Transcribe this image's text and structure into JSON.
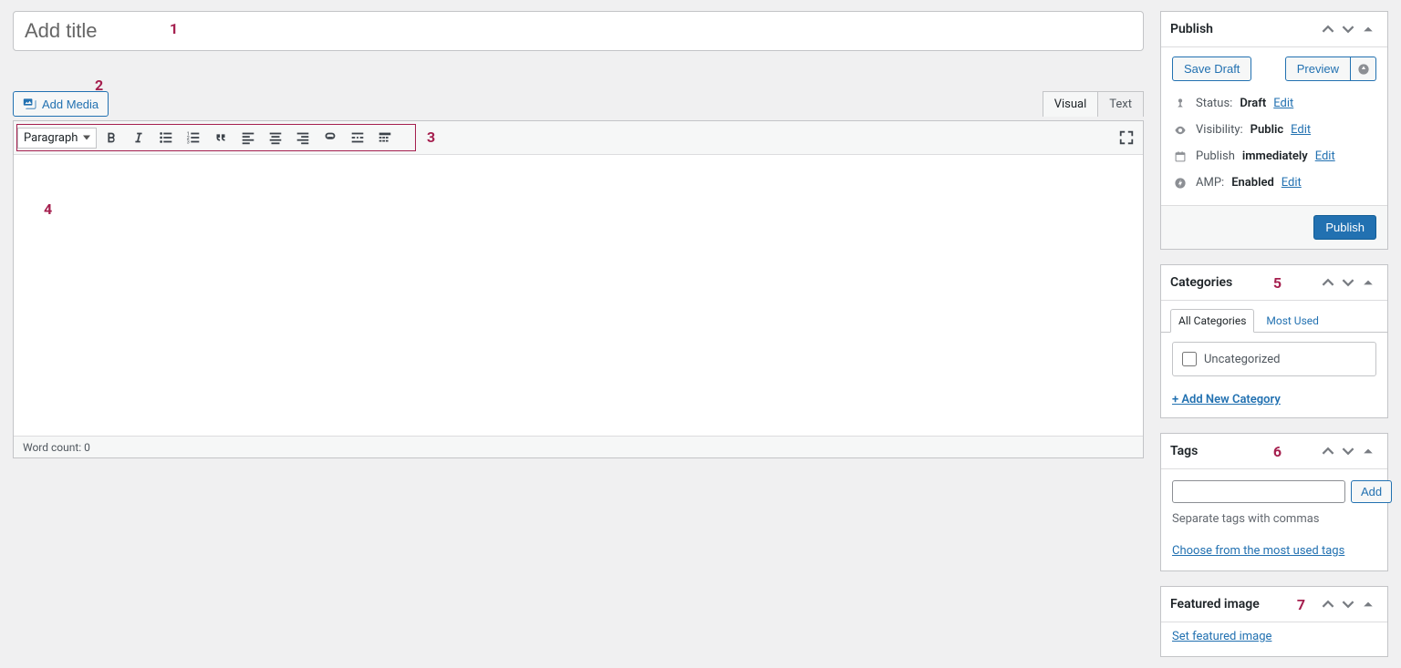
{
  "title_placeholder": "Add title",
  "add_media_label": "Add Media",
  "tabs": {
    "visual": "Visual",
    "text": "Text"
  },
  "para_select": "Paragraph",
  "word_count_label": "Word count: 0",
  "annotations": {
    "a1": "1",
    "a2": "2",
    "a3": "3",
    "a4": "4",
    "a5": "5",
    "a6": "6",
    "a7": "7"
  },
  "publish": {
    "title": "Publish",
    "save_draft": "Save Draft",
    "preview": "Preview",
    "status_label": "Status:",
    "status_value": "Draft",
    "visibility_label": "Visibility:",
    "visibility_value": "Public",
    "schedule_label": "Publish",
    "schedule_value": "immediately",
    "amp_label": "AMP:",
    "amp_value": "Enabled",
    "edit": "Edit",
    "publish_btn": "Publish"
  },
  "categories": {
    "title": "Categories",
    "tab_all": "All Categories",
    "tab_most": "Most Used",
    "item": "Uncategorized",
    "add_new": "+ Add New Category"
  },
  "tags": {
    "title": "Tags",
    "add": "Add",
    "help": "Separate tags with commas",
    "choose": "Choose from the most used tags"
  },
  "featured": {
    "title": "Featured image",
    "set": "Set featured image"
  }
}
